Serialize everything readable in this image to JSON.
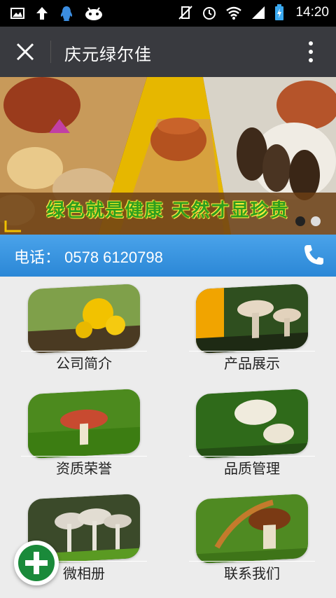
{
  "status_bar": {
    "time": "14:20"
  },
  "app_bar": {
    "title": "庆元绿尔佳"
  },
  "banner": {
    "slogan": "绿色就是健康 天然才显珍贵",
    "active_slide": 1,
    "slide_count": 2
  },
  "phone_bar": {
    "text": "电话： 0578 6120798"
  },
  "menu": {
    "items": [
      {
        "label": "公司简介",
        "name": "menu-item-company-intro"
      },
      {
        "label": "产品展示",
        "name": "menu-item-products"
      },
      {
        "label": "资质荣誉",
        "name": "menu-item-honors"
      },
      {
        "label": "品质管理",
        "name": "menu-item-quality"
      },
      {
        "label": "微相册",
        "name": "menu-item-album"
      },
      {
        "label": "联系我们",
        "name": "menu-item-contact"
      }
    ]
  },
  "colors": {
    "accent_blue": "#2b87d6",
    "app_bar": "#393a3f",
    "fab_green": "#1a8a3a"
  }
}
